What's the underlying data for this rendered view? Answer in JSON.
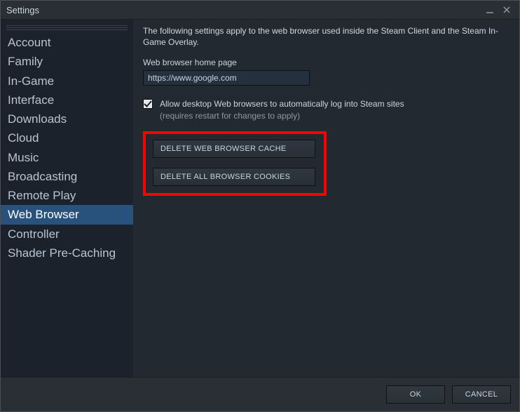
{
  "window": {
    "title": "Settings"
  },
  "sidebar": {
    "items": [
      {
        "label": "Account"
      },
      {
        "label": "Family"
      },
      {
        "label": "In-Game"
      },
      {
        "label": "Interface"
      },
      {
        "label": "Downloads"
      },
      {
        "label": "Cloud"
      },
      {
        "label": "Music"
      },
      {
        "label": "Broadcasting"
      },
      {
        "label": "Remote Play"
      },
      {
        "label": "Web Browser"
      },
      {
        "label": "Controller"
      },
      {
        "label": "Shader Pre-Caching"
      }
    ],
    "selected_index": 9
  },
  "main": {
    "description": "The following settings apply to the web browser used inside the Steam Client and the Steam In-Game Overlay.",
    "homepage_label": "Web browser home page",
    "homepage_value": "https://www.google.com",
    "autologin_checked": true,
    "autologin_main": "Allow desktop Web browsers to automatically log into Steam sites",
    "autologin_sub": "(requires restart for changes to apply)",
    "delete_cache_label": "DELETE WEB BROWSER CACHE",
    "delete_cookies_label": "DELETE ALL BROWSER COOKIES"
  },
  "footer": {
    "ok_label": "OK",
    "cancel_label": "CANCEL"
  }
}
